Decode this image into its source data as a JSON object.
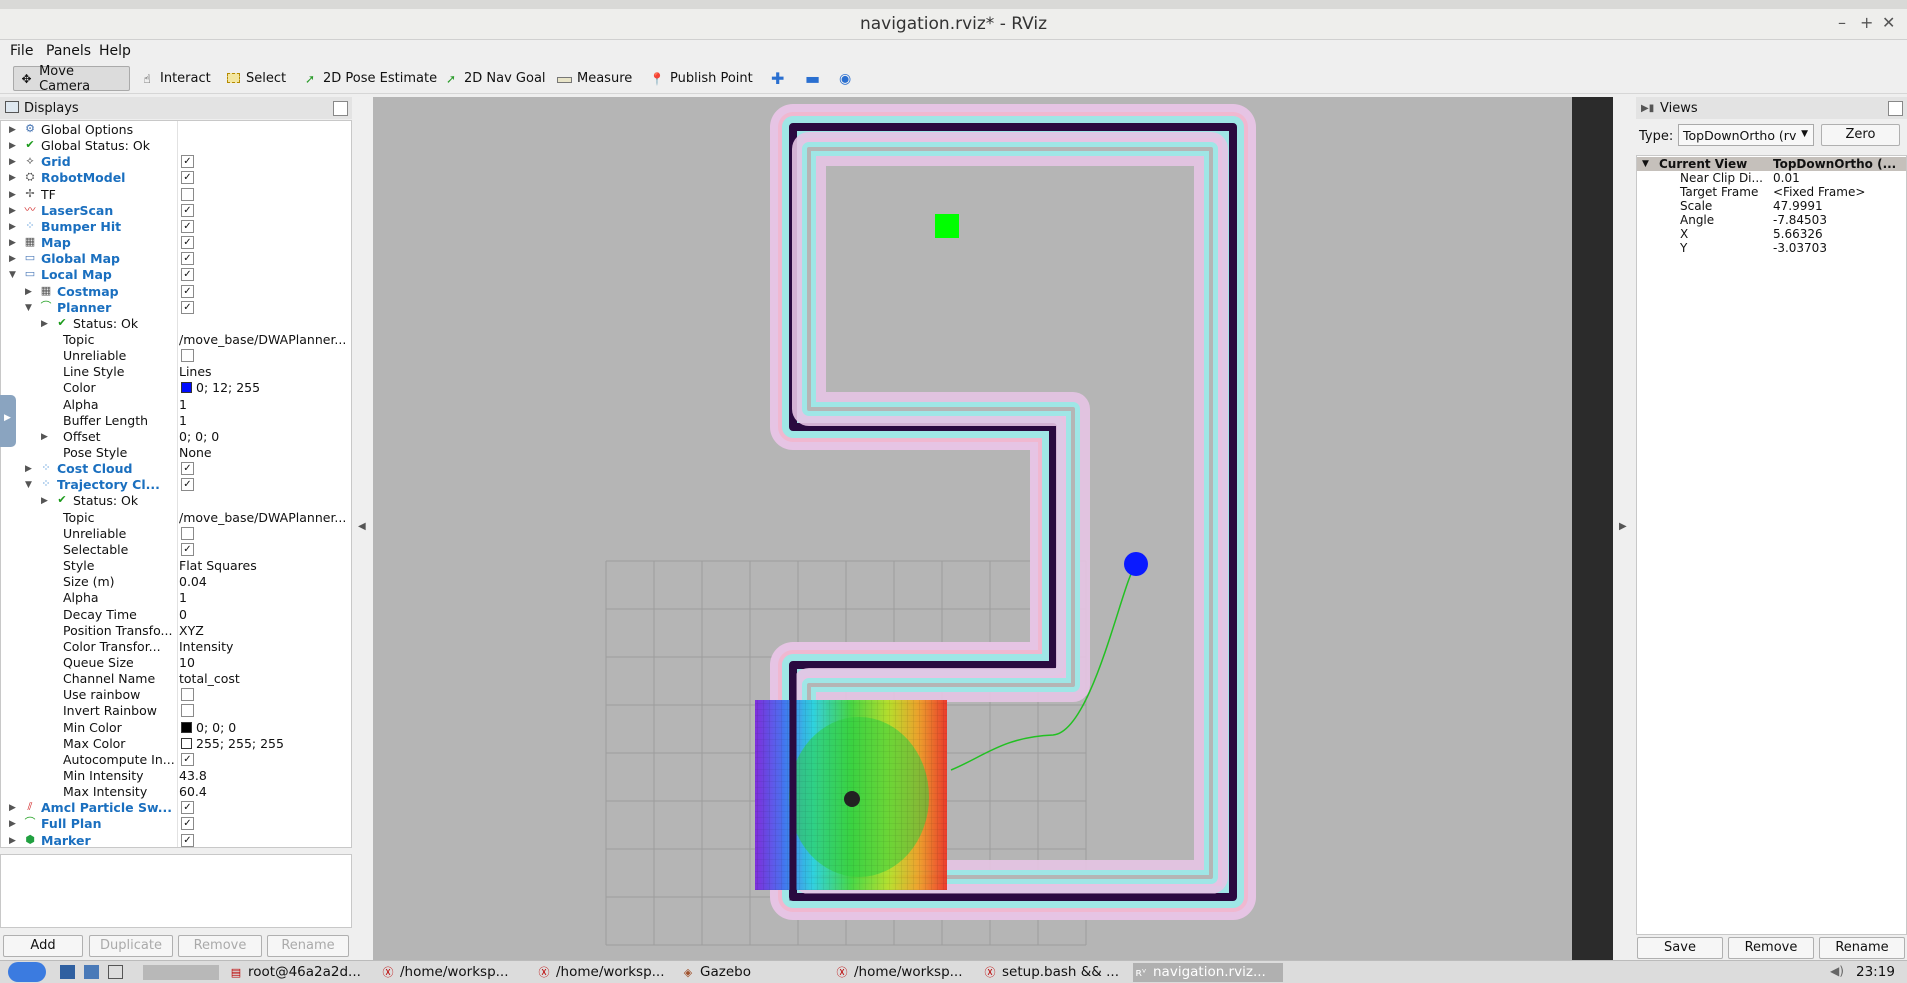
{
  "window": {
    "title": "navigation.rviz* - RViz",
    "top_title": "Gazebo"
  },
  "menu": [
    "File",
    "Panels",
    "Help"
  ],
  "toolbar": [
    {
      "label": "Move Camera",
      "icon": "move-camera-icon",
      "active": true
    },
    {
      "label": "Interact",
      "icon": "hand-icon"
    },
    {
      "label": "Select",
      "icon": "select-box-icon"
    },
    {
      "label": "2D Pose Estimate",
      "icon": "green-arrow-icon"
    },
    {
      "label": "2D Nav Goal",
      "icon": "green-arrow-icon"
    },
    {
      "label": "Measure",
      "icon": "ruler-icon"
    },
    {
      "label": "Publish Point",
      "icon": "map-pin-icon"
    }
  ],
  "displays": {
    "title": "Displays",
    "rows": [
      {
        "name": "Global Options",
        "indent": 0,
        "icon": "gear-icon"
      },
      {
        "name": "Global Status: Ok",
        "indent": 0,
        "icon": "check-icon"
      },
      {
        "name": "Grid",
        "indent": 0,
        "bold": true,
        "checked": true,
        "icon": "grid-icon"
      },
      {
        "name": "RobotModel",
        "indent": 0,
        "bold": true,
        "checked": true,
        "icon": "robot-icon"
      },
      {
        "name": "TF",
        "indent": 0,
        "checked": false,
        "icon": "tf-icon"
      },
      {
        "name": "LaserScan",
        "indent": 0,
        "bold": true,
        "checked": true,
        "icon": "laser-icon"
      },
      {
        "name": "Bumper Hit",
        "indent": 0,
        "bold": true,
        "checked": true,
        "icon": "pointcloud-icon"
      },
      {
        "name": "Map",
        "indent": 0,
        "bold": true,
        "checked": true,
        "icon": "map-icon"
      },
      {
        "name": "Global Map",
        "indent": 0,
        "bold": true,
        "checked": true,
        "icon": "folder-icon"
      },
      {
        "name": "Local Map",
        "indent": 0,
        "bold": true,
        "checked": true,
        "expanded": true,
        "icon": "folder-icon"
      },
      {
        "name": "Costmap",
        "indent": 1,
        "bold": true,
        "checked": true,
        "icon": "map-icon"
      },
      {
        "name": "Planner",
        "indent": 1,
        "bold": true,
        "checked": true,
        "expanded": true,
        "icon": "path-icon"
      },
      {
        "name": "Status: Ok",
        "indent": 2,
        "icon": "check-icon"
      },
      {
        "name": "Topic",
        "indent": 2,
        "value": "/move_base/DWAPlanner...",
        "noarrow": true
      },
      {
        "name": "Unreliable",
        "indent": 2,
        "checked": false,
        "noarrow": true
      },
      {
        "name": "Line Style",
        "indent": 2,
        "value": "Lines",
        "noarrow": true
      },
      {
        "name": "Color",
        "indent": 2,
        "value": "0; 12; 255",
        "swatch": "#000cff",
        "noarrow": true
      },
      {
        "name": "Alpha",
        "indent": 2,
        "value": "1",
        "noarrow": true
      },
      {
        "name": "Buffer Length",
        "indent": 2,
        "value": "1",
        "noarrow": true
      },
      {
        "name": "Offset",
        "indent": 2,
        "value": "0; 0; 0"
      },
      {
        "name": "Pose Style",
        "indent": 2,
        "value": "None",
        "noarrow": true
      },
      {
        "name": "Cost Cloud",
        "indent": 1,
        "bold": true,
        "checked": true,
        "icon": "pointcloud-icon"
      },
      {
        "name": "Trajectory Cl...",
        "indent": 1,
        "bold": true,
        "checked": true,
        "expanded": true,
        "icon": "pointcloud-icon"
      },
      {
        "name": "Status: Ok",
        "indent": 2,
        "icon": "check-icon"
      },
      {
        "name": "Topic",
        "indent": 2,
        "value": "/move_base/DWAPlanner...",
        "noarrow": true
      },
      {
        "name": "Unreliable",
        "indent": 2,
        "checked": false,
        "noarrow": true
      },
      {
        "name": "Selectable",
        "indent": 2,
        "checked": true,
        "noarrow": true
      },
      {
        "name": "Style",
        "indent": 2,
        "value": "Flat Squares",
        "noarrow": true
      },
      {
        "name": "Size (m)",
        "indent": 2,
        "value": "0.04",
        "noarrow": true
      },
      {
        "name": "Alpha",
        "indent": 2,
        "value": "1",
        "noarrow": true
      },
      {
        "name": "Decay Time",
        "indent": 2,
        "value": "0",
        "noarrow": true
      },
      {
        "name": "Position Transfo...",
        "indent": 2,
        "value": "XYZ",
        "noarrow": true
      },
      {
        "name": "Color Transfor...",
        "indent": 2,
        "value": "Intensity",
        "noarrow": true
      },
      {
        "name": "Queue Size",
        "indent": 2,
        "value": "10",
        "noarrow": true
      },
      {
        "name": "Channel Name",
        "indent": 2,
        "value": "total_cost",
        "noarrow": true
      },
      {
        "name": "Use rainbow",
        "indent": 2,
        "checked": false,
        "noarrow": true
      },
      {
        "name": "Invert Rainbow",
        "indent": 2,
        "checked": false,
        "noarrow": true
      },
      {
        "name": "Min Color",
        "indent": 2,
        "value": "0; 0; 0",
        "swatch": "#000000",
        "noarrow": true
      },
      {
        "name": "Max Color",
        "indent": 2,
        "value": "255; 255; 255",
        "swatch": "#ffffff",
        "noarrow": true
      },
      {
        "name": "Autocompute In...",
        "indent": 2,
        "checked": true,
        "noarrow": true
      },
      {
        "name": "Min Intensity",
        "indent": 2,
        "value": "43.8",
        "noarrow": true
      },
      {
        "name": "Max Intensity",
        "indent": 2,
        "value": "60.4",
        "noarrow": true
      },
      {
        "name": "Amcl Particle Sw...",
        "indent": 0,
        "bold": true,
        "checked": true,
        "icon": "particle-icon"
      },
      {
        "name": "Full Plan",
        "indent": 0,
        "bold": true,
        "checked": true,
        "icon": "path-icon"
      },
      {
        "name": "Marker",
        "indent": 0,
        "bold": true,
        "checked": true,
        "icon": "marker-icon"
      }
    ],
    "buttons": {
      "add": "Add",
      "duplicate": "Duplicate",
      "remove": "Remove",
      "rename": "Rename"
    }
  },
  "views": {
    "title": "Views",
    "type_label": "Type:",
    "type_value": "TopDownOrtho (rv",
    "zero": "Zero",
    "current_view": {
      "name": "Current View",
      "value": "TopDownOrtho (..."
    },
    "props": [
      {
        "name": "Near Clip Di...",
        "value": "0.01"
      },
      {
        "name": "Target Frame",
        "value": "<Fixed Frame>"
      },
      {
        "name": "Scale",
        "value": "47.9991"
      },
      {
        "name": "Angle",
        "value": "-7.84503"
      },
      {
        "name": "X",
        "value": "5.66326"
      },
      {
        "name": "Y",
        "value": "-3.03703"
      }
    ],
    "buttons": {
      "save": "Save",
      "remove": "Remove",
      "rename": "Rename"
    }
  },
  "taskbar": {
    "items": [
      {
        "label": "root@46a2a2d...",
        "icon": "terminal-icon"
      },
      {
        "label": "/home/worksp...",
        "icon": "editor-icon"
      },
      {
        "label": "/home/worksp...",
        "icon": "editor-icon"
      },
      {
        "label": "Gazebo",
        "icon": "gazebo-icon"
      },
      {
        "label": "/home/worksp...",
        "icon": "editor-icon"
      },
      {
        "label": "setup.bash && ...",
        "icon": "editor-icon"
      },
      {
        "label": "navigation.rviz...",
        "icon": "rviz-icon",
        "active": true
      }
    ],
    "clock": "23:19"
  }
}
